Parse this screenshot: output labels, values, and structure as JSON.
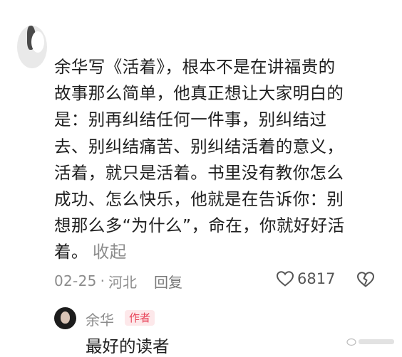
{
  "comment": {
    "lines": [
      "余华写《活着》，根本不是在讲福贵的",
      "故事那么简单，他真正想让大家明白的",
      "是：别再纠结任何一件事，别纠结过",
      "去、别纠结痛苦、别纠结活着的意义，",
      "活着，就只是活着。书里没有教你怎么",
      "成功、怎么快乐，他就是在告诉你：别",
      "想那么多“为什么”，命在，你就好好活",
      "着。"
    ],
    "collapse_label": "收起",
    "date": "02-25",
    "separator": "·",
    "location": "河北",
    "reply_label": "回复",
    "like_count": "6817"
  },
  "reply": {
    "author": "余华",
    "badge": "作者",
    "text": "最好的读者"
  },
  "icons": {
    "like": "heart-outline-icon",
    "dislike": "broken-heart-icon"
  },
  "colors": {
    "text": "#1f1f1f",
    "muted": "#8c8c8c",
    "badge_bg": "#fde8ea",
    "badge_text": "#e8465b"
  }
}
